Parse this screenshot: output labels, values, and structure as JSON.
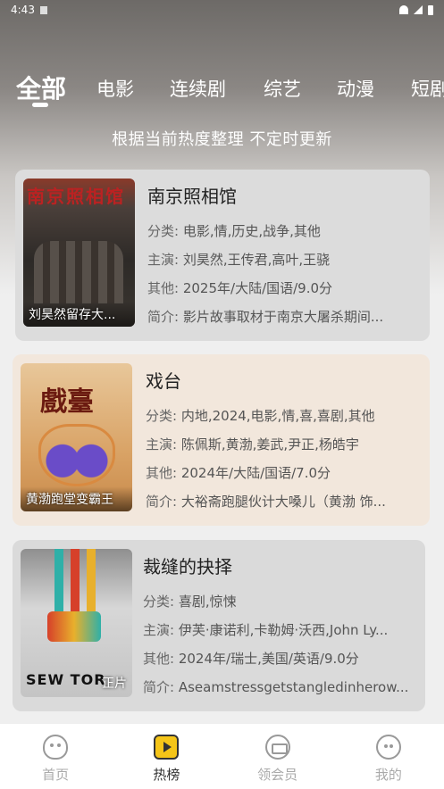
{
  "status_bar": {
    "time": "4:43"
  },
  "tabs": [
    {
      "label": "全部",
      "active": true
    },
    {
      "label": "电影",
      "active": false
    },
    {
      "label": "连续剧",
      "active": false
    },
    {
      "label": "综艺",
      "active": false
    },
    {
      "label": "动漫",
      "active": false
    },
    {
      "label": "短剧",
      "active": false
    }
  ],
  "subtitle": "根据当前热度整理 不定时更新",
  "cards": [
    {
      "title": "南京照相馆",
      "poster_art": "南京照相馆",
      "poster_caption": "刘昊然留存大...",
      "category_label": "分类:",
      "category": "电影,情,历史,战争,其他",
      "cast_label": "主演:",
      "cast": "刘昊然,王传君,高叶,王骁",
      "other_label": "其他:",
      "other": "2025年/大陆/国语/9.0分",
      "intro_label": "简介:",
      "intro": "影片故事取材于南京大屠杀期间..."
    },
    {
      "title": "戏台",
      "poster_art": "戲臺",
      "poster_caption": "黄渤跑堂变霸王",
      "category_label": "分类:",
      "category": "内地,2024,电影,情,喜,喜剧,其他",
      "cast_label": "主演:",
      "cast": "陈佩斯,黄渤,姜武,尹正,杨皓宇",
      "other_label": "其他:",
      "other": "2024年/大陆/国语/7.0分",
      "intro_label": "简介:",
      "intro": "大裕斋跑腿伙计大嗓儿（黄渤 饰..."
    },
    {
      "title": "裁缝的抉择",
      "poster_art": "SEW TOR",
      "poster_caption": "正片",
      "category_label": "分类:",
      "category": "喜剧,惊悚",
      "cast_label": "主演:",
      "cast": "伊芙·康诺利,卡勒姆·沃西,John Ly...",
      "other_label": "其他:",
      "other": "2024年/瑞士,美国/英语/9.0分",
      "intro_label": "简介:",
      "intro": "Aseamstressgetstangledinherow..."
    }
  ],
  "bottom_nav": [
    {
      "label": "首页",
      "icon": "home-icon",
      "active": false
    },
    {
      "label": "热榜",
      "icon": "hot-list-icon",
      "active": true
    },
    {
      "label": "领会员",
      "icon": "vip-icon",
      "active": false
    },
    {
      "label": "我的",
      "icon": "profile-icon",
      "active": false
    }
  ],
  "colors": {
    "accent": "#f5c518",
    "active_text": "#333333",
    "inactive_text": "#aaaaaa"
  }
}
